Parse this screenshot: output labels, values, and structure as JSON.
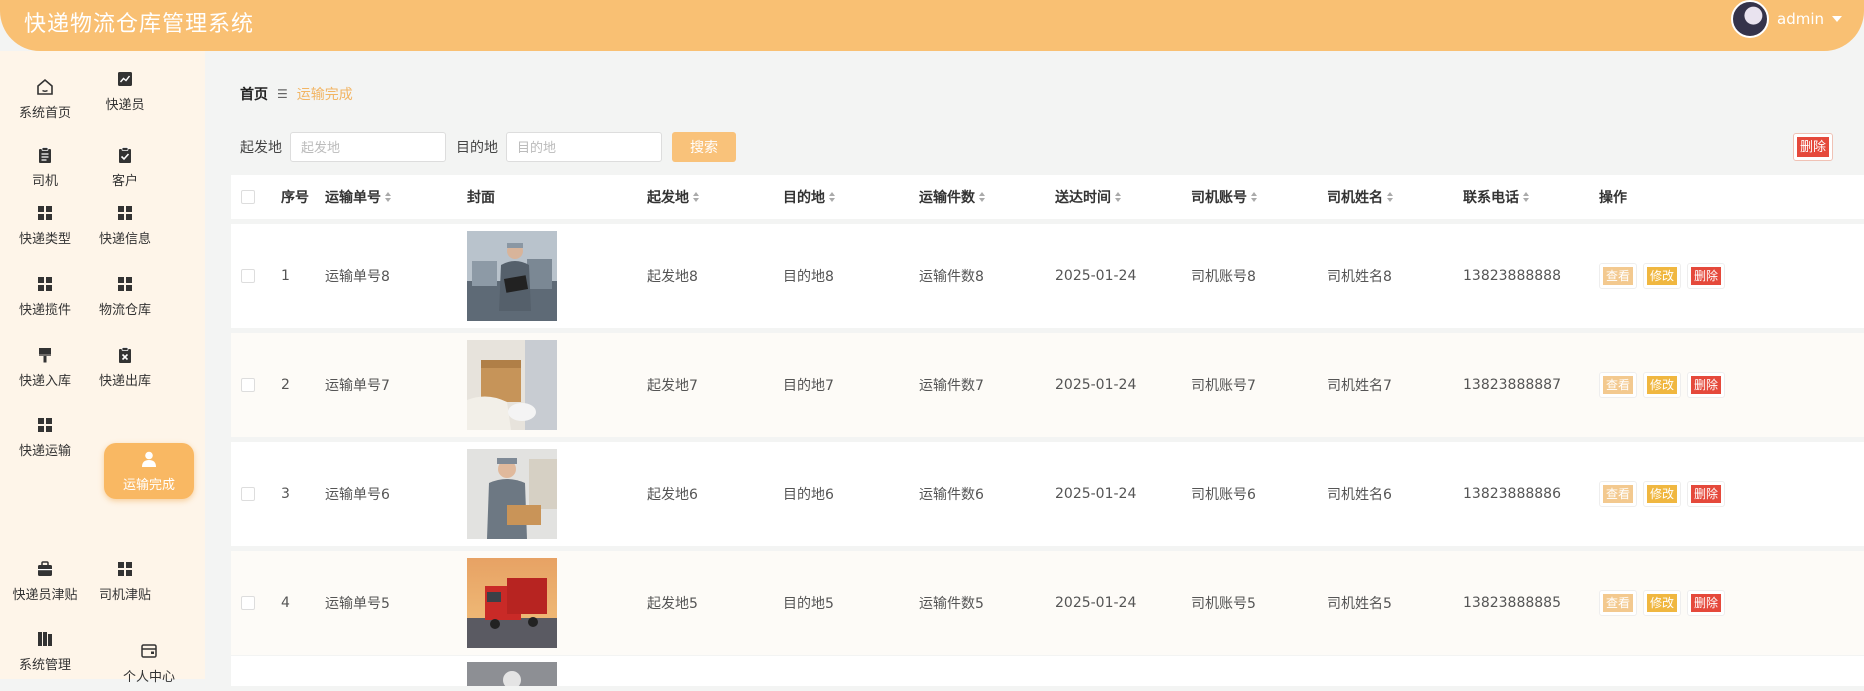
{
  "app": {
    "title": "快递物流仓库管理系统",
    "user": "admin"
  },
  "sidebar": {
    "items": [
      {
        "label": "系统首页",
        "icon": "home-icon",
        "active": false
      },
      {
        "label": "快递员",
        "icon": "chart-icon",
        "active": false
      },
      {
        "label": "司机",
        "icon": "clipboard-icon",
        "active": false
      },
      {
        "label": "客户",
        "icon": "clipboard-check-icon",
        "active": false
      },
      {
        "label": "快递类型",
        "icon": "grid-icon",
        "active": false
      },
      {
        "label": "快递信息",
        "icon": "grid-icon",
        "active": false
      },
      {
        "label": "快递揽件",
        "icon": "grid-icon",
        "active": false
      },
      {
        "label": "物流仓库",
        "icon": "grid-icon",
        "active": false
      },
      {
        "label": "快递入库",
        "icon": "brush-icon",
        "active": false
      },
      {
        "label": "快递出库",
        "icon": "clipboard-x-icon",
        "active": false
      },
      {
        "label": "快递运输",
        "icon": "grid-icon",
        "active": false
      },
      {
        "label": "运输完成",
        "icon": "user-icon",
        "active": true
      },
      {
        "label": "快递员津贴",
        "icon": "briefcase-icon",
        "active": false
      },
      {
        "label": "司机津贴",
        "icon": "grid-icon",
        "active": false
      },
      {
        "label": "系统管理",
        "icon": "book-icon",
        "active": false
      },
      {
        "label": "个人中心",
        "icon": "wallet-icon",
        "active": false
      }
    ]
  },
  "breadcrumb": {
    "home": "首页",
    "separator": "☰",
    "current": "运输完成"
  },
  "search": {
    "origin_label": "起发地",
    "origin_placeholder": "起发地",
    "dest_label": "目的地",
    "dest_placeholder": "目的地",
    "search_button": "搜索",
    "delete_button": "删除"
  },
  "table": {
    "columns": [
      "序号",
      "运输单号",
      "封面",
      "起发地",
      "目的地",
      "运输件数",
      "送达时间",
      "司机账号",
      "司机姓名",
      "联系电话",
      "操作"
    ],
    "rows": [
      {
        "index": "1",
        "order": "运输单号8",
        "image": "photo-worker-warehouse-tablet",
        "origin": "起发地8",
        "dest": "目的地8",
        "count": "运输件数8",
        "time": "2025-01-24",
        "account": "司机账号8",
        "name": "司机姓名8",
        "phone": "13823888888"
      },
      {
        "index": "2",
        "order": "运输单号7",
        "image": "photo-hands-parcel-box",
        "origin": "起发地7",
        "dest": "目的地7",
        "count": "运输件数7",
        "time": "2025-01-24",
        "account": "司机账号7",
        "name": "司机姓名7",
        "phone": "13823888887"
      },
      {
        "index": "3",
        "order": "运输单号6",
        "image": "photo-courier-scanning",
        "origin": "起发地6",
        "dest": "目的地6",
        "count": "运输件数6",
        "time": "2025-01-24",
        "account": "司机账号6",
        "name": "司机姓名6",
        "phone": "13823888886"
      },
      {
        "index": "4",
        "order": "运输单号5",
        "image": "photo-red-truck-sunset",
        "origin": "起发地5",
        "dest": "目的地5",
        "count": "运输件数5",
        "time": "2025-01-24",
        "account": "司机账号5",
        "name": "司机姓名5",
        "phone": "13823888885"
      }
    ],
    "actions": {
      "view": "查看",
      "edit": "修改",
      "delete": "删除"
    }
  },
  "colors": {
    "header": "#f9c073",
    "active": "#f9b863",
    "view": "#f3c98f",
    "edit": "#f0b740",
    "delete": "#e5493b"
  }
}
